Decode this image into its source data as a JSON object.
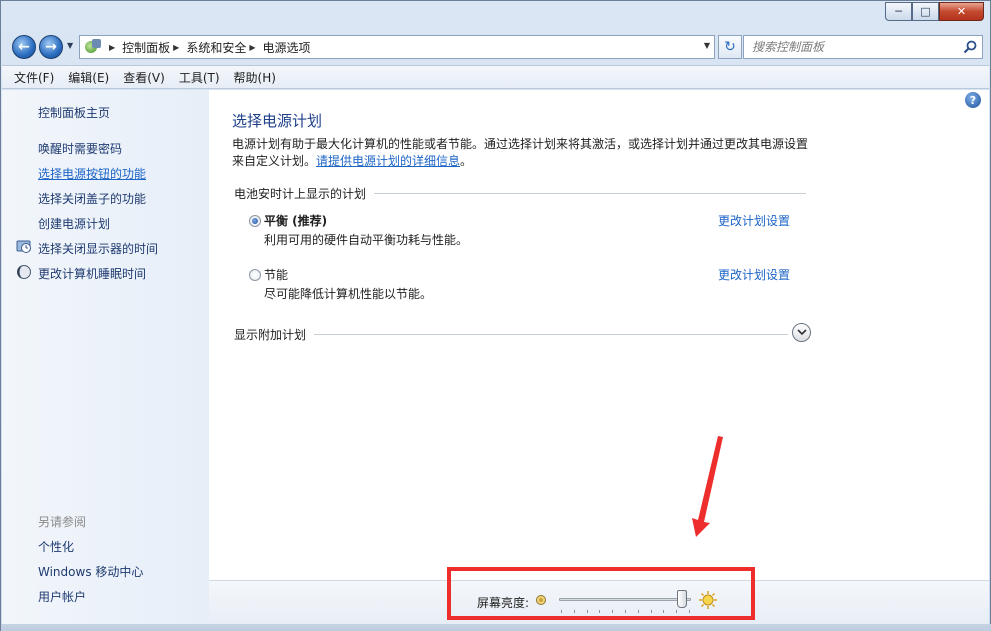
{
  "window": {
    "minimize": "─",
    "maximize": "□",
    "close": "✕"
  },
  "nav": {
    "back": "←",
    "forward": "→",
    "breadcrumbs": [
      "控制面板",
      "系统和安全",
      "电源选项"
    ],
    "refresh": "↻",
    "search_placeholder": "搜索控制面板"
  },
  "menu": [
    "文件(F)",
    "编辑(E)",
    "查看(V)",
    "工具(T)",
    "帮助(H)"
  ],
  "sidebar": {
    "home": "控制面板主页",
    "items": [
      {
        "label": "唤醒时需要密码",
        "icon": ""
      },
      {
        "label": "选择电源按钮的功能",
        "icon": "",
        "active": true
      },
      {
        "label": "选择关闭盖子的功能",
        "icon": ""
      },
      {
        "label": "创建电源计划",
        "icon": ""
      },
      {
        "label": "选择关闭显示器的时间",
        "icon": "monitor-clock-icon"
      },
      {
        "label": "更改计算机睡眠时间",
        "icon": "moon-icon"
      }
    ],
    "see_also_title": "另请参阅",
    "see_also": [
      "个性化",
      "Windows 移动中心",
      "用户帐户"
    ]
  },
  "main": {
    "help": "?",
    "title": "选择电源计划",
    "intro_text": "电源计划有助于最大化计算机的性能或者节能。通过选择计划来将其激活，或选择计划并通过更改其电源设置来自定义计划。",
    "intro_link": "请提供电源计划的详细信息",
    "intro_end": "。",
    "battery_section": "电池安时计上显示的计划",
    "plans": [
      {
        "name": "平衡 (推荐)",
        "desc": "利用可用的硬件自动平衡功耗与性能。",
        "link": "更改计划设置",
        "selected": true
      },
      {
        "name": "节能",
        "desc": "尽可能降低计算机性能以节能。",
        "link": "更改计划设置",
        "selected": false
      }
    ],
    "more_plans": "显示附加计划"
  },
  "bottom": {
    "brightness_label": "屏幕亮度:",
    "brightness_value": 0.93
  },
  "colors": {
    "link": "#1c64c6",
    "title": "#1e3f8a",
    "highlight": "#ee2d2d"
  }
}
